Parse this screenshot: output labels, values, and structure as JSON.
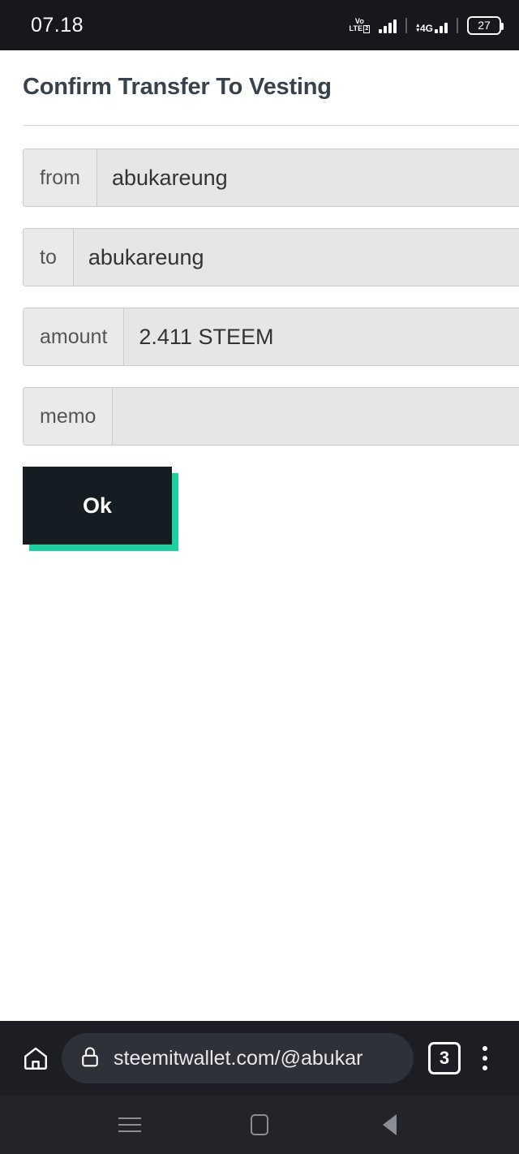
{
  "statusbar": {
    "time": "07.18",
    "volte": {
      "line1": "Vo",
      "line2": "LTE",
      "sim_badge": "2"
    },
    "network": {
      "label": "4G",
      "arrow_up": "▴",
      "arrow_down": "▾"
    },
    "battery": {
      "level": "27"
    }
  },
  "page": {
    "title": "Confirm Transfer To Vesting",
    "rows": [
      {
        "label": "from",
        "value": "abukareung"
      },
      {
        "label": "to",
        "value": "abukareung"
      },
      {
        "label": "amount",
        "value": "2.411 STEEM"
      },
      {
        "label": "memo",
        "value": ""
      }
    ],
    "ok_label": "Ok"
  },
  "browser": {
    "home_icon": "home-icon",
    "lock_icon": "lock-icon",
    "url": "steemitwallet.com/@abukar",
    "tab_count": "3",
    "menu_icon": "overflow-menu-icon"
  },
  "navbar": {
    "recents": "recents-icon",
    "home": "home-square-icon",
    "back": "back-triangle-icon"
  },
  "colors": {
    "accent_teal": "#1ad1a0",
    "button_dark": "#151c22",
    "status_bg": "#16181d",
    "field_bg": "#e6e6e6"
  }
}
